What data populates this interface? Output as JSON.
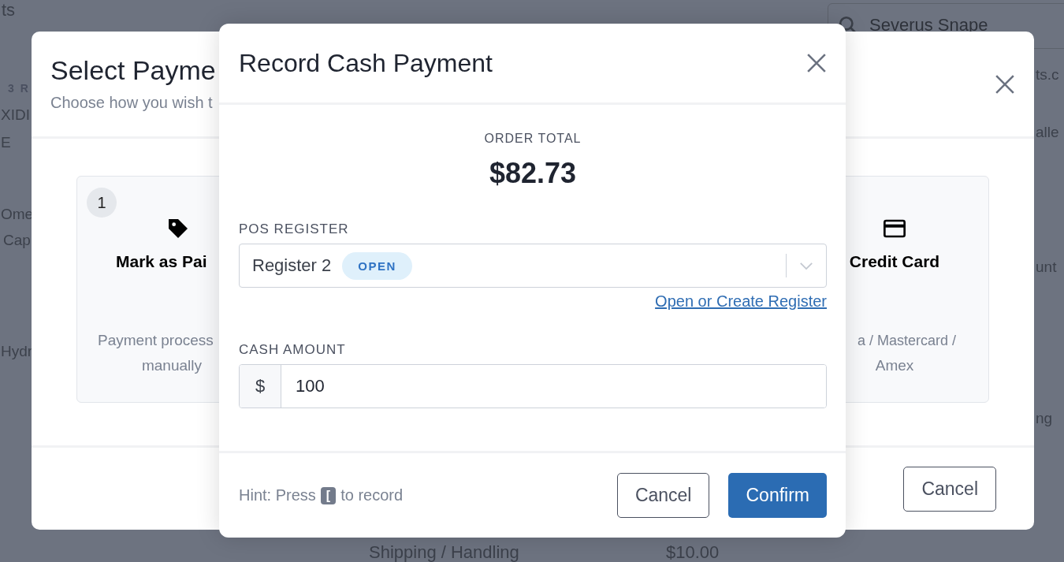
{
  "background": {
    "search": {
      "value": "Severus Snape"
    },
    "fragments": [
      {
        "text": "ts"
      },
      {
        "text": "3 R"
      },
      {
        "text": "XIDI"
      },
      {
        "text": "E"
      },
      {
        "text": "Ome"
      },
      {
        "text": "Cap"
      },
      {
        "text": "Hydr"
      },
      {
        "text": "ts.c"
      },
      {
        "text": "alle"
      },
      {
        "text": "unt"
      },
      {
        "text": "ng"
      },
      {
        "text": "Shipping / Handling"
      },
      {
        "text": "$10.00"
      }
    ]
  },
  "payment_dialog": {
    "title": "Select Payme",
    "subtitle": "Choose how you wish t",
    "options": [
      {
        "number": "1",
        "kind": "tag",
        "title": "Mark as Pai",
        "description": [
          "Payment process",
          "manually"
        ]
      },
      {
        "kind": "card",
        "title": "Credit Card",
        "description": [
          "a / Mastercard /",
          "Amex"
        ]
      }
    ],
    "cancel": "Cancel"
  },
  "cash_dialog": {
    "title": "Record Cash Payment",
    "total_label": "ORDER TOTAL",
    "total": "$82.73",
    "register": {
      "label": "POS REGISTER",
      "value": "Register 2",
      "badge": "OPEN",
      "link": "Open or Create Register"
    },
    "cash": {
      "label": "CASH AMOUNT",
      "prefix": "$",
      "value": "100"
    },
    "hint": {
      "before": "Hint: Press",
      "key": "[",
      "after": "to record"
    },
    "cancel": "Cancel",
    "confirm": "Confirm"
  }
}
